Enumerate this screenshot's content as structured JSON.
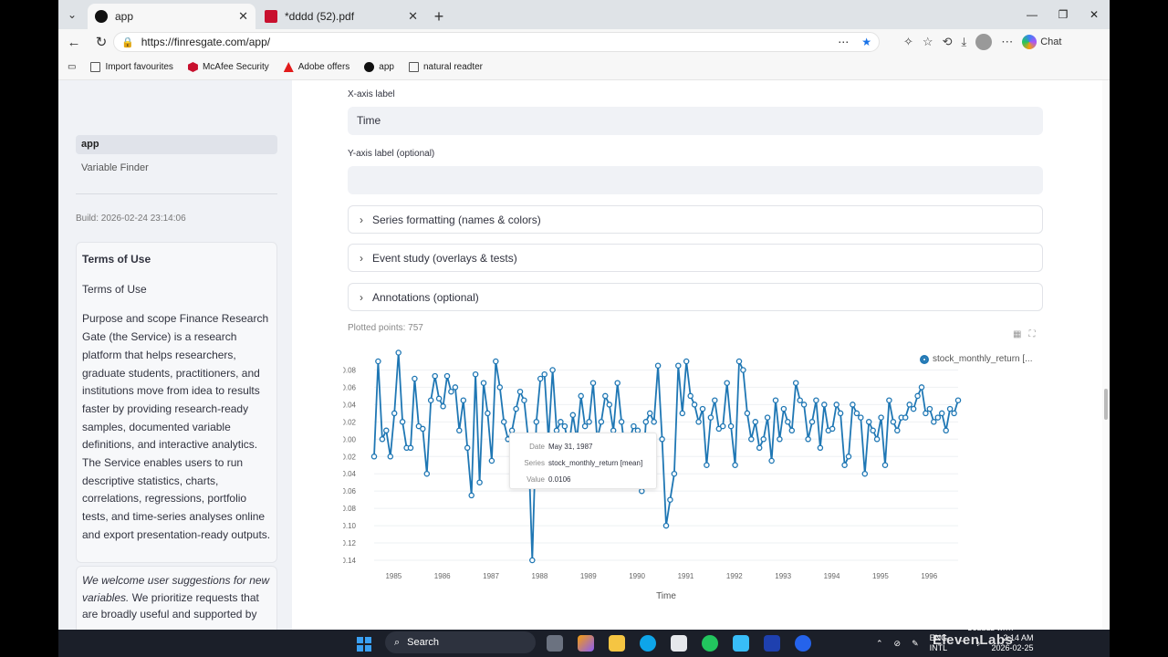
{
  "browser": {
    "tabs": [
      {
        "title": "app",
        "active": true
      },
      {
        "title": "*dddd (52).pdf",
        "active": false
      }
    ],
    "url": "https://finresgate.com/app/",
    "bookmarks": [
      "Import favourites",
      "McAfee Security",
      "Adobe offers",
      "app",
      "natural readter"
    ],
    "chat_label": "Chat"
  },
  "sidebar": {
    "nav": [
      "app",
      "Variable Finder"
    ],
    "build": "Build: 2026-02-24 23:14:06",
    "terms_heading": "Terms of Use",
    "terms_subheading": "Terms of Use",
    "terms_body": "Purpose and scope Finance Research Gate (the Service) is a research platform that helps researchers, graduate students, practitioners, and institutions move from idea to results faster by providing research-ready samples, documented variable definitions, and interactive analytics. The Service enables users to run descriptive statistics, charts, correlations, regressions, portfolio tests, and time-series analyses online and export presentation-ready outputs.",
    "suggest_italic": "We welcome user suggestions for new variables.",
    "suggest_rest": " We prioritize requests that are broadly useful and supported by"
  },
  "form": {
    "x_label_title": "X-axis label",
    "x_label_value": "Time",
    "y_label_title": "Y-axis label (optional)",
    "y_label_value": "",
    "expanders": [
      "Series formatting (names & colors)",
      "Event study (overlays & tests)",
      "Annotations (optional)"
    ],
    "plotted": "Plotted points: 757"
  },
  "chart_data": {
    "type": "line",
    "xlabel": "Time",
    "ylabel": "",
    "series": [
      {
        "name": "stock_monthly_return [...",
        "x_start": 1984.6,
        "x_step": 0.0833,
        "values": [
          -0.02,
          0.09,
          0.0,
          0.01,
          -0.02,
          0.03,
          0.1,
          0.02,
          -0.01,
          -0.01,
          0.07,
          0.015,
          0.012,
          -0.04,
          0.045,
          0.073,
          0.047,
          0.038,
          0.073,
          0.055,
          0.06,
          0.01,
          0.045,
          -0.01,
          -0.065,
          0.075,
          -0.05,
          0.065,
          0.03,
          -0.025,
          0.09,
          0.06,
          0.02,
          0.0,
          0.01,
          0.035,
          0.055,
          0.045,
          0.0,
          -0.14,
          0.02,
          0.07,
          0.075,
          0.0,
          0.08,
          0.01,
          0.02,
          0.015,
          -0.01,
          0.028,
          0.0,
          0.05,
          0.015,
          0.02,
          0.065,
          0.0,
          0.02,
          0.05,
          0.04,
          0.01,
          0.065,
          0.02,
          -0.02,
          0.0,
          0.015,
          0.01,
          -0.06,
          0.02,
          0.03,
          0.02,
          0.085,
          0.0,
          -0.1,
          -0.07,
          -0.04,
          0.085,
          0.03,
          0.09,
          0.05,
          0.04,
          0.02,
          0.035,
          -0.03,
          0.025,
          0.045,
          0.012,
          0.015,
          0.065,
          0.015,
          -0.03,
          0.09,
          0.08,
          0.03,
          0.0,
          0.02,
          -0.01,
          0.0,
          0.025,
          -0.025,
          0.045,
          0.0,
          0.035,
          0.02,
          0.01,
          0.065,
          0.045,
          0.04,
          0.0,
          0.02,
          0.045,
          -0.01,
          0.04,
          0.01,
          0.012,
          0.04,
          0.03,
          -0.03,
          -0.02,
          0.04,
          0.03,
          0.025,
          -0.04,
          0.02,
          0.01,
          0.0,
          0.025,
          -0.03,
          0.045,
          0.02,
          0.01,
          0.025,
          0.025,
          0.04,
          0.035,
          0.05,
          0.06,
          0.03,
          0.035,
          0.02,
          0.025,
          0.03,
          0.01,
          0.035,
          0.03,
          0.045
        ],
        "color": "#1f77b4"
      }
    ],
    "ylim": [
      -0.14,
      0.09
    ],
    "y_ticks": [
      "0.08",
      "0.06",
      "0.04",
      "0.02",
      "0.00",
      "0.02",
      "0.04",
      "0.06",
      "0.08",
      "0.10",
      "0.12",
      "0.14"
    ],
    "x_ticks": [
      "1985",
      "1986",
      "1987",
      "1988",
      "1989",
      "1990",
      "1991",
      "1992",
      "1993",
      "1994",
      "1995",
      "1996"
    ],
    "legend_position": "top-right",
    "tooltip": {
      "Date": "May 31, 1987",
      "Series": "stock_monthly_return [mean]",
      "Value": "0.0106"
    }
  },
  "taskbar": {
    "search": "Search",
    "lang": [
      "ENG",
      "INTL"
    ],
    "time": "2:14 AM",
    "date": "2026-02-25"
  },
  "watermark": {
    "small": "DUBBED WITH",
    "big": "ElevenLabs"
  }
}
